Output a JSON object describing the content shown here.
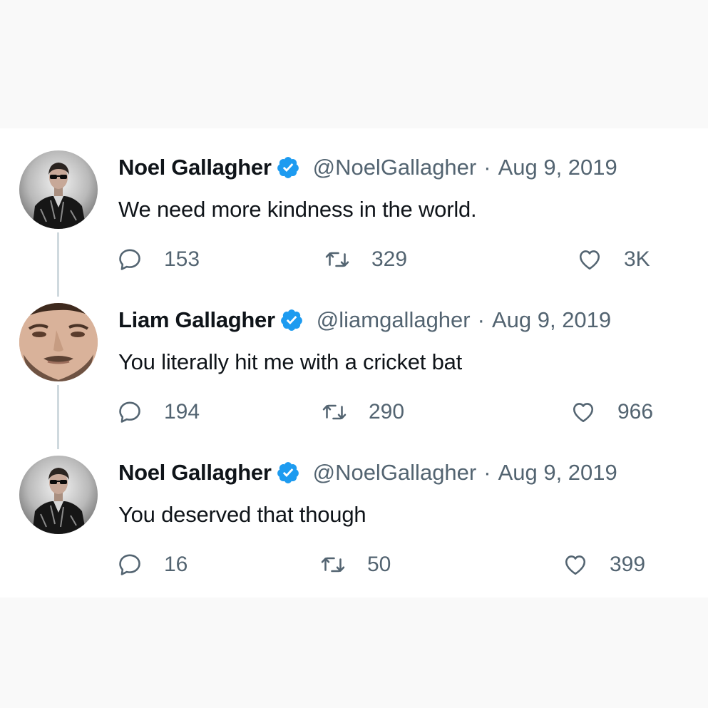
{
  "tweets": [
    {
      "name": "Noel Gallagher",
      "handle": "@NoelGallagher",
      "separator": "·",
      "date": "Aug 9, 2019",
      "text": "We need more kindness in the world.",
      "replies": "153",
      "retweets": "329",
      "likes": "3K",
      "avatar": "noel-gallagher-photo"
    },
    {
      "name": "Liam Gallagher",
      "handle": "@liamgallagher",
      "separator": "·",
      "date": "Aug 9, 2019",
      "text": "You literally hit me with a cricket bat",
      "replies": "194",
      "retweets": "290",
      "likes": "966",
      "avatar": "liam-gallagher-photo"
    },
    {
      "name": "Noel Gallagher",
      "handle": "@NoelGallagher",
      "separator": "·",
      "date": "Aug 9, 2019",
      "text": "You deserved that though",
      "replies": "16",
      "retweets": "50",
      "likes": "399",
      "avatar": "noel-gallagher-photo"
    }
  ],
  "icons": {
    "verified": "verified-badge-icon",
    "reply": "reply-icon",
    "retweet": "retweet-icon",
    "like": "like-icon"
  },
  "colors": {
    "verified_blue": "#1d9bf0",
    "text": "#0f1419",
    "secondary": "#536471",
    "thread_line": "#cfd9de"
  }
}
